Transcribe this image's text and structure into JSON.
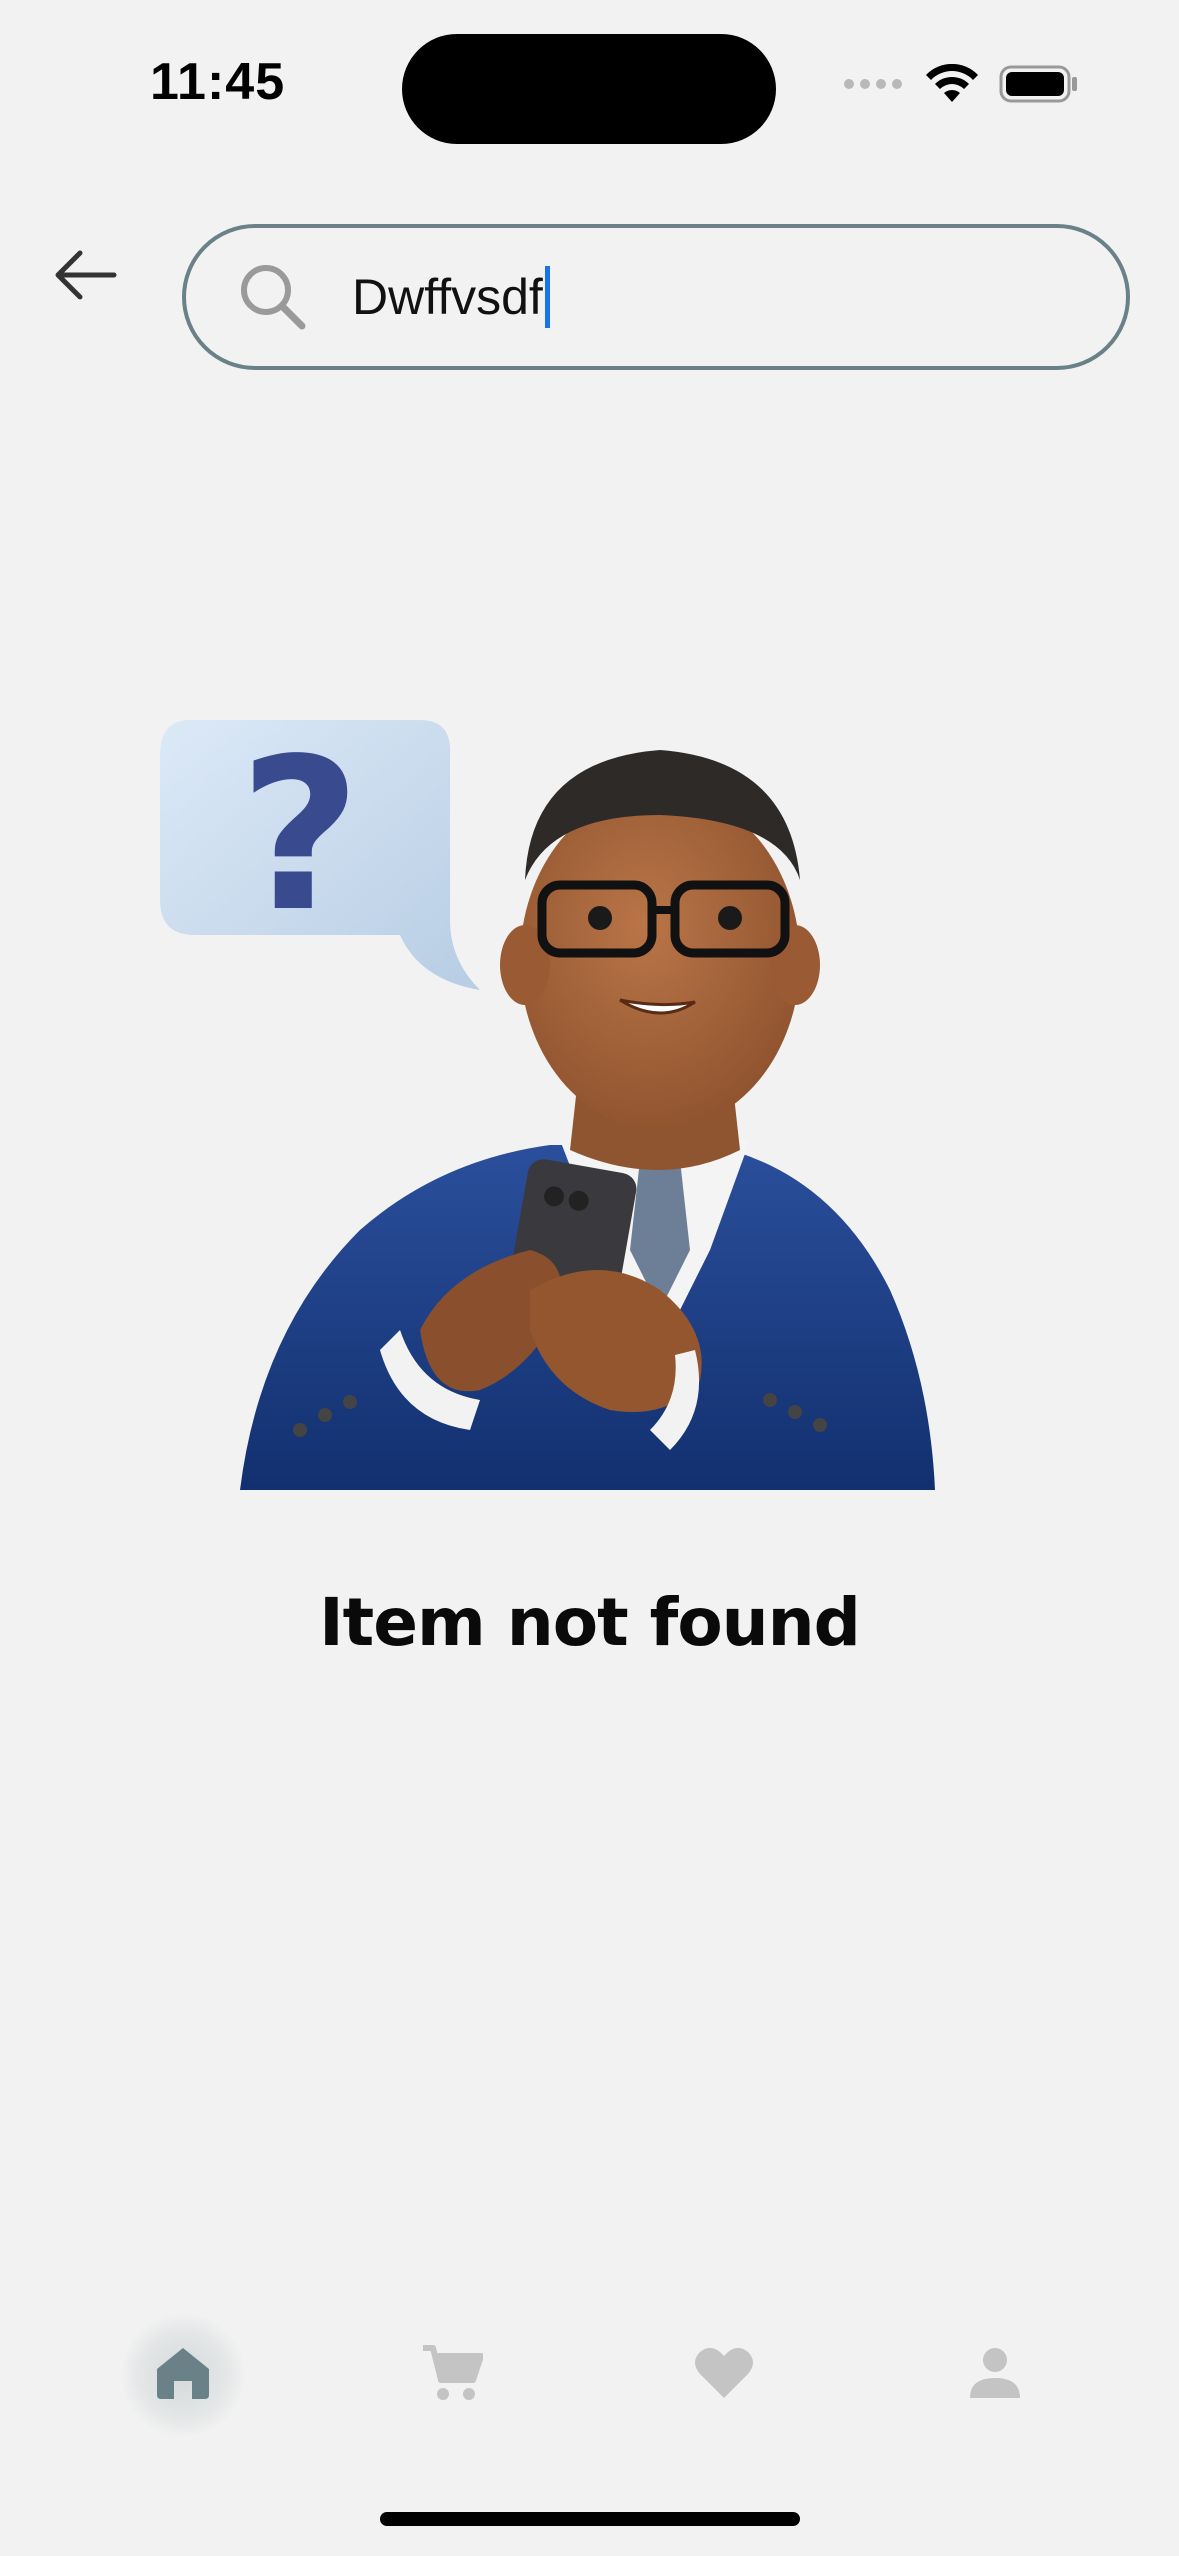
{
  "status_bar": {
    "time": "11:45",
    "icons": [
      "signal-icon",
      "wifi-icon",
      "battery-icon"
    ]
  },
  "header": {
    "back_icon": "arrow-left-icon",
    "search": {
      "icon": "search-icon",
      "value": "Dwffvsdf"
    }
  },
  "empty_state": {
    "illustration": "man-with-phone-and-question-bubble",
    "title": "Item not found"
  },
  "bottom_nav": {
    "items": [
      {
        "icon": "home-icon",
        "active": true
      },
      {
        "icon": "cart-icon",
        "active": false
      },
      {
        "icon": "heart-icon",
        "active": false
      },
      {
        "icon": "person-icon",
        "active": false
      }
    ]
  },
  "colors": {
    "background": "#f2f2f2",
    "accent": "#6a8188",
    "inactive_icon": "#c4c4c4",
    "caret": "#1a73e8"
  }
}
